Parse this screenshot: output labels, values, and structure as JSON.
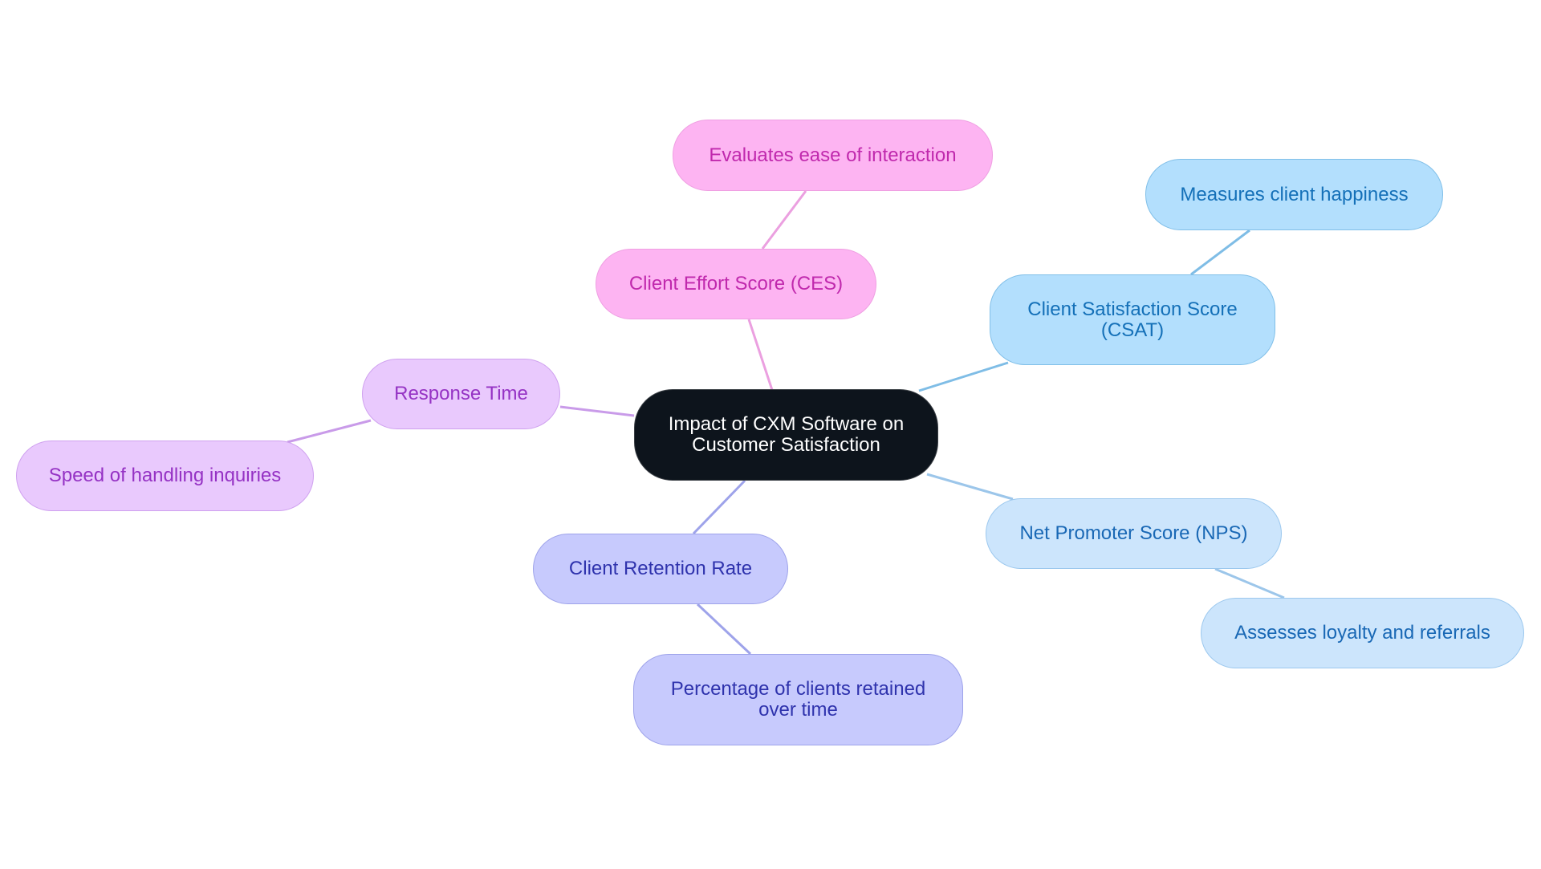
{
  "diagram": {
    "type": "mindmap",
    "root": {
      "id": "root",
      "label": "Impact of CXM Software on Customer Satisfaction",
      "lines": [
        "Impact of CXM Software on",
        "Customer Satisfaction"
      ]
    },
    "branches": [
      {
        "id": "ces",
        "label": "Client Effort Score (CES)",
        "color": "#fdb4f2",
        "children": [
          {
            "id": "ces-desc",
            "label": "Evaluates ease of interaction"
          }
        ]
      },
      {
        "id": "csat",
        "label": "Client Satisfaction Score (CSAT)",
        "lines": [
          "Client Satisfaction Score",
          "(CSAT)"
        ],
        "color": "#b3dffd",
        "children": [
          {
            "id": "csat-desc",
            "label": "Measures client happiness"
          }
        ]
      },
      {
        "id": "nps",
        "label": "Net Promoter Score (NPS)",
        "color": "#cce5fc",
        "children": [
          {
            "id": "nps-desc",
            "label": "Assesses loyalty and referrals"
          }
        ]
      },
      {
        "id": "retention",
        "label": "Client Retention Rate",
        "color": "#c7cafd",
        "children": [
          {
            "id": "retention-desc",
            "label": "Percentage of clients retained over time",
            "lines": [
              "Percentage of clients retained",
              "over time"
            ]
          }
        ]
      },
      {
        "id": "response",
        "label": "Response Time",
        "color": "#e9c9fd",
        "children": [
          {
            "id": "response-desc",
            "label": "Speed of handling inquiries"
          }
        ]
      }
    ],
    "colors": {
      "root_fill": "#0d141c",
      "ces_edge": "#eba0e0",
      "csat_edge": "#7fbde6",
      "nps_edge": "#9cc6ea",
      "retention_edge": "#9ea3ea",
      "response_edge": "#c99be9"
    }
  }
}
